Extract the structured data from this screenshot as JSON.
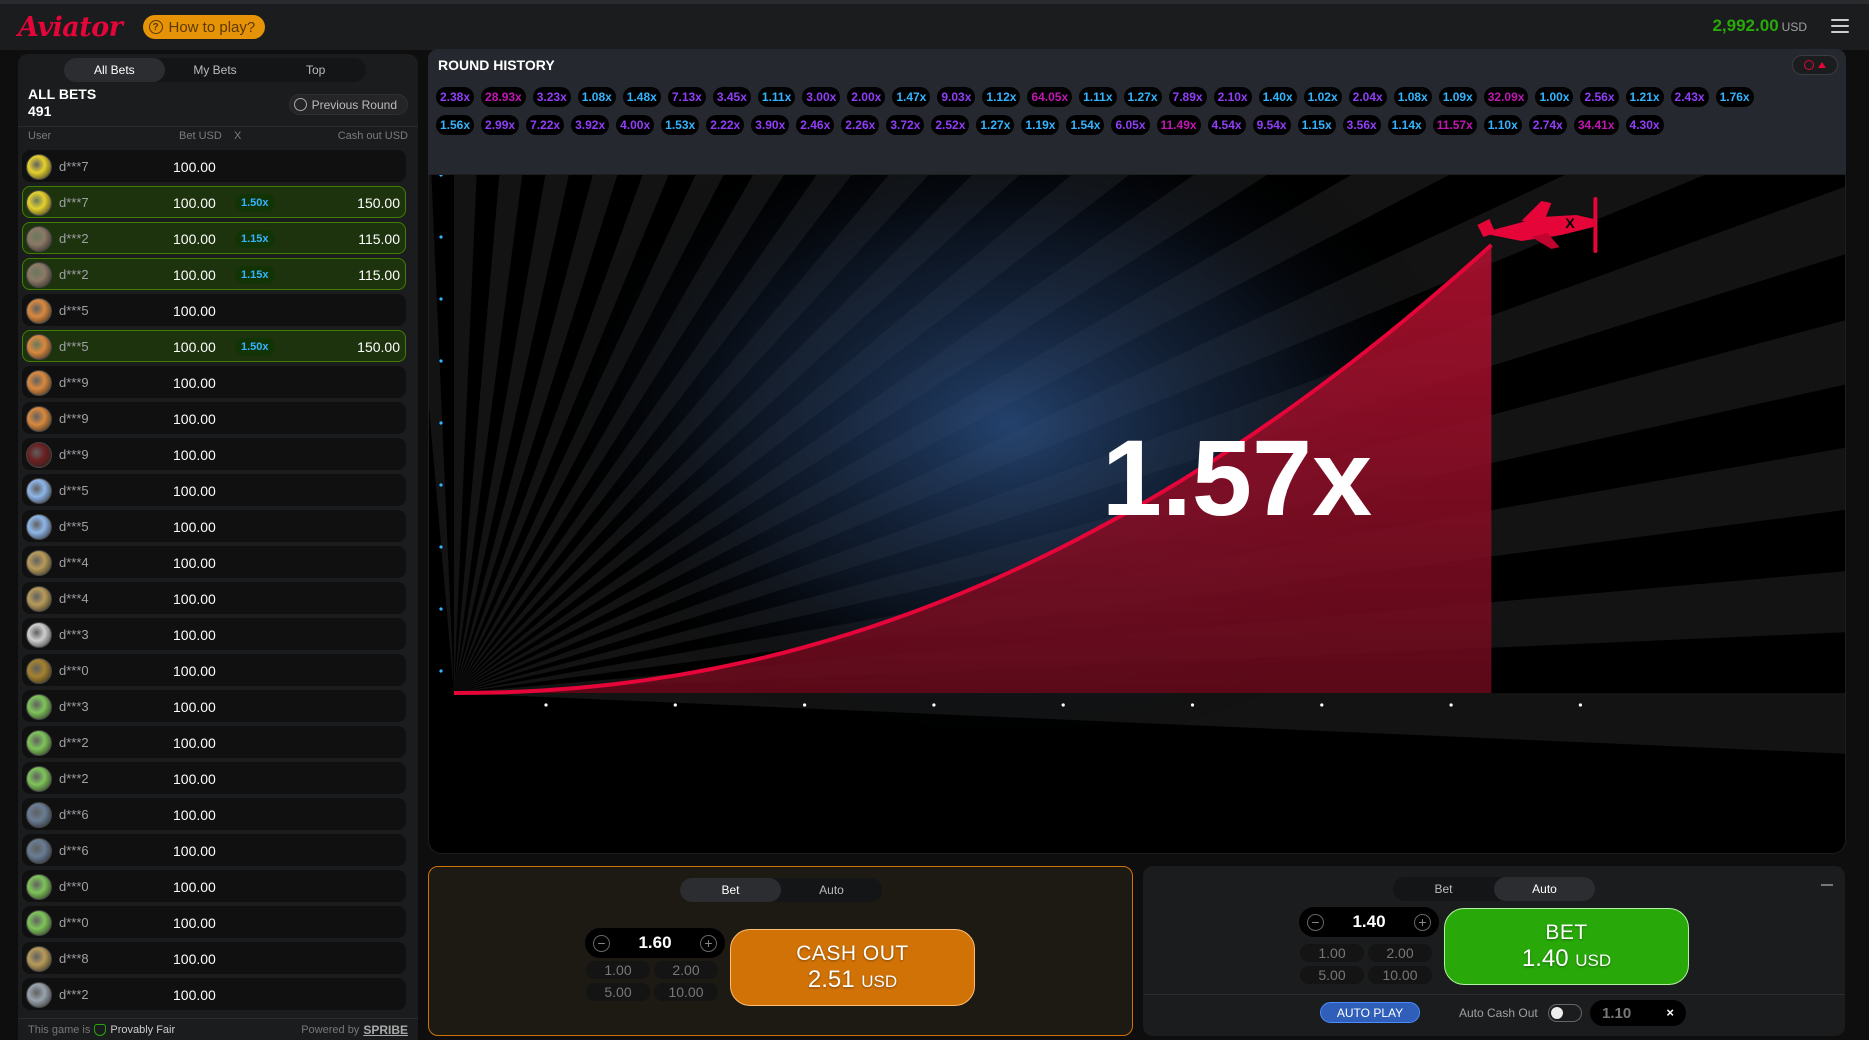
{
  "header": {
    "logo": "Aviator",
    "how_to_play": "How to play?",
    "balance": "2,992.00",
    "currency": "USD"
  },
  "left": {
    "tabs": [
      "All Bets",
      "My Bets",
      "Top"
    ],
    "active_tab": 0,
    "title": "ALL BETS",
    "count": "491",
    "previous_round": "Previous Round",
    "columns": {
      "user": "User",
      "bet": "Bet USD",
      "x": "X",
      "cashout": "Cash out USD"
    },
    "rows": [
      {
        "user": "d***7",
        "bet": "100.00",
        "mult": "",
        "cash": "",
        "won": false,
        "avatar": "#e5d12e"
      },
      {
        "user": "d***7",
        "bet": "100.00",
        "mult": "1.50x",
        "cash": "150.00",
        "won": true,
        "avatar": "#e5d12e"
      },
      {
        "user": "d***2",
        "bet": "100.00",
        "mult": "1.15x",
        "cash": "115.00",
        "won": true,
        "avatar": "#8c7a66"
      },
      {
        "user": "d***2",
        "bet": "100.00",
        "mult": "1.15x",
        "cash": "115.00",
        "won": true,
        "avatar": "#8c7a66"
      },
      {
        "user": "d***5",
        "bet": "100.00",
        "mult": "",
        "cash": "",
        "won": false,
        "avatar": "#d9893f"
      },
      {
        "user": "d***5",
        "bet": "100.00",
        "mult": "1.50x",
        "cash": "150.00",
        "won": true,
        "avatar": "#d9893f"
      },
      {
        "user": "d***9",
        "bet": "100.00",
        "mult": "",
        "cash": "",
        "won": false,
        "avatar": "#d9893f"
      },
      {
        "user": "d***9",
        "bet": "100.00",
        "mult": "",
        "cash": "",
        "won": false,
        "avatar": "#d9893f"
      },
      {
        "user": "d***9",
        "bet": "100.00",
        "mult": "",
        "cash": "",
        "won": false,
        "avatar": "#6b2020"
      },
      {
        "user": "d***5",
        "bet": "100.00",
        "mult": "",
        "cash": "",
        "won": false,
        "avatar": "#8fb6e8"
      },
      {
        "user": "d***5",
        "bet": "100.00",
        "mult": "",
        "cash": "",
        "won": false,
        "avatar": "#8fb6e8"
      },
      {
        "user": "d***4",
        "bet": "100.00",
        "mult": "",
        "cash": "",
        "won": false,
        "avatar": "#b89b5a"
      },
      {
        "user": "d***4",
        "bet": "100.00",
        "mult": "",
        "cash": "",
        "won": false,
        "avatar": "#b89b5a"
      },
      {
        "user": "d***3",
        "bet": "100.00",
        "mult": "",
        "cash": "",
        "won": false,
        "avatar": "#cfcfcf"
      },
      {
        "user": "d***0",
        "bet": "100.00",
        "mult": "",
        "cash": "",
        "won": false,
        "avatar": "#a5822e"
      },
      {
        "user": "d***3",
        "bet": "100.00",
        "mult": "",
        "cash": "",
        "won": false,
        "avatar": "#7fc45a"
      },
      {
        "user": "d***2",
        "bet": "100.00",
        "mult": "",
        "cash": "",
        "won": false,
        "avatar": "#7fc45a"
      },
      {
        "user": "d***2",
        "bet": "100.00",
        "mult": "",
        "cash": "",
        "won": false,
        "avatar": "#7fc45a"
      },
      {
        "user": "d***6",
        "bet": "100.00",
        "mult": "",
        "cash": "",
        "won": false,
        "avatar": "#6a7d94"
      },
      {
        "user": "d***6",
        "bet": "100.00",
        "mult": "",
        "cash": "",
        "won": false,
        "avatar": "#6a7d94"
      },
      {
        "user": "d***0",
        "bet": "100.00",
        "mult": "",
        "cash": "",
        "won": false,
        "avatar": "#7fc45a"
      },
      {
        "user": "d***0",
        "bet": "100.00",
        "mult": "",
        "cash": "",
        "won": false,
        "avatar": "#7fc45a"
      },
      {
        "user": "d***8",
        "bet": "100.00",
        "mult": "",
        "cash": "",
        "won": false,
        "avatar": "#b89b5a"
      },
      {
        "user": "d***2",
        "bet": "100.00",
        "mult": "",
        "cash": "",
        "won": false,
        "avatar": "#9aa3ad"
      }
    ],
    "footer": {
      "prefix": "This game is",
      "provably_fair": "Provably Fair",
      "powered_by": "Powered by",
      "brand": "SPRIBE"
    }
  },
  "history": {
    "title": "ROUND HISTORY",
    "chips": [
      "2.38x",
      "28.93x",
      "3.23x",
      "1.08x",
      "1.48x",
      "7.13x",
      "3.45x",
      "1.11x",
      "3.00x",
      "2.00x",
      "1.47x",
      "9.03x",
      "1.12x",
      "64.05x",
      "1.11x",
      "1.27x",
      "7.89x",
      "2.10x",
      "1.40x",
      "1.02x",
      "2.04x",
      "1.08x",
      "1.09x",
      "32.09x",
      "1.00x",
      "2.56x",
      "1.21x",
      "2.43x",
      "1.76x",
      "1.56x",
      "2.99x",
      "7.22x",
      "3.92x",
      "4.00x",
      "1.53x",
      "2.22x",
      "3.90x",
      "2.46x",
      "2.26x",
      "3.72x",
      "2.52x",
      "1.27x",
      "1.19x",
      "1.54x",
      "6.05x",
      "11.49x",
      "4.54x",
      "9.54x",
      "1.15x",
      "3.56x",
      "1.14x",
      "11.57x",
      "1.10x",
      "2.74x",
      "34.41x",
      "4.30x"
    ]
  },
  "colors": {
    "blue": "#34b4ff",
    "purple": "#913ef8",
    "pink": "#c017b4",
    "red": "#e50539",
    "green": "#28a909",
    "orange": "#d07206"
  },
  "game": {
    "multiplier": "1.57x",
    "curve_progress": 0.76
  },
  "panel1": {
    "tabs": [
      "Bet",
      "Auto"
    ],
    "active_tab": 0,
    "amount": "1.60",
    "quick": [
      "1.00",
      "2.00",
      "5.00",
      "10.00"
    ],
    "button_title": "CASH OUT",
    "button_value": "2.51",
    "button_currency": "USD"
  },
  "panel2": {
    "tabs": [
      "Bet",
      "Auto"
    ],
    "active_tab": 1,
    "amount": "1.40",
    "quick": [
      "1.00",
      "2.00",
      "5.00",
      "10.00"
    ],
    "button_title": "BET",
    "button_value": "1.40",
    "button_currency": "USD",
    "auto_play": "AUTO PLAY",
    "auto_cashout_label": "Auto Cash Out",
    "auto_cashout_value": "1.10",
    "auto_cashout_enabled": false
  },
  "icons": {
    "question": "question-icon",
    "menu": "hamburger-menu-icon",
    "history": "history-icon",
    "plane": "airplane-icon",
    "shield": "shield-check-icon"
  }
}
